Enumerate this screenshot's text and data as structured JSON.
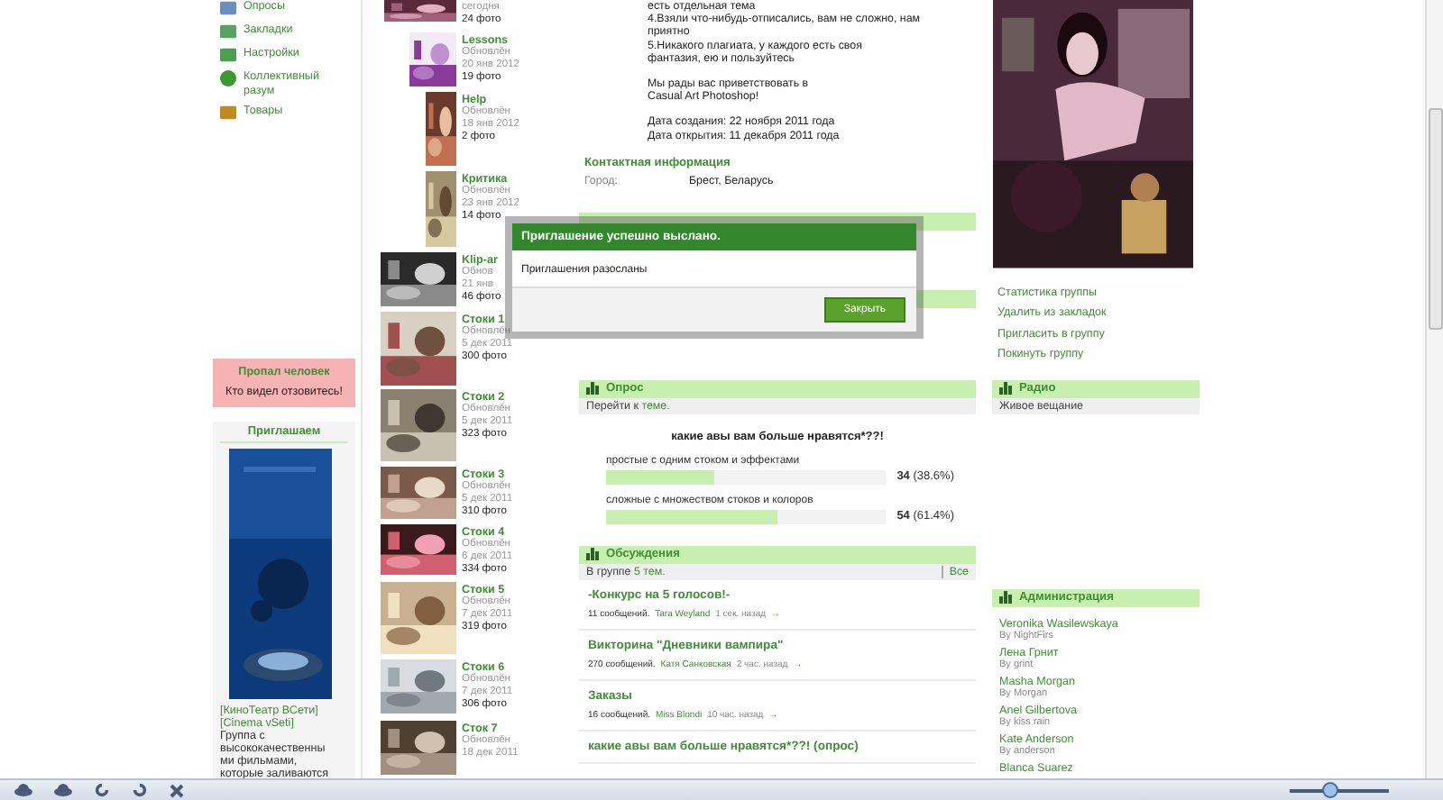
{
  "left_menu": [
    {
      "label": "Опросы"
    },
    {
      "label": "Закладки"
    },
    {
      "label": "Настройки"
    },
    {
      "label": "Коллективный разум"
    },
    {
      "label": "Товары"
    }
  ],
  "missing_box": {
    "title": "Пропал человек",
    "text": "Кто видел отзовитесь!"
  },
  "invite_box": {
    "title": "Приглашаем",
    "link": "[КиноТеатр ВСети] [Cinema vSeti]",
    "text": "Группа с высококачественными фильмами, которые заливаются"
  },
  "albums": [
    {
      "date": "сегодня",
      "count": "24 фото"
    },
    {
      "title": "Lessons",
      "status": "Обновлён",
      "date": "20 янв 2012",
      "count": "19 фото"
    },
    {
      "title": "Help",
      "status": "Обновлён",
      "date": "18 янв 2012",
      "count": "2 фото"
    },
    {
      "title": "Критика",
      "status": "Обновлён",
      "date": "23 янв 2012",
      "count": "14 фото"
    },
    {
      "title": "Klip-ar",
      "status": "Обнов",
      "date": "21 янв",
      "count": "46 фото"
    },
    {
      "title": "Стоки 1",
      "status": "Обновлён",
      "date": "5 дек 2011",
      "count": "300 фото"
    },
    {
      "title": "Стоки 2",
      "status": "Обновлён",
      "date": "5 дек 2011",
      "count": "323 фото"
    },
    {
      "title": "Стоки 3",
      "status": "Обновлён",
      "date": "5 дек 2011",
      "count": "310 фото"
    },
    {
      "title": "Стоки 4",
      "status": "Обновлён",
      "date": "6 дек 2011",
      "count": "334 фото"
    },
    {
      "title": "Стоки 5",
      "status": "Обновлён",
      "date": "7 дек 2011",
      "count": "319 фото"
    },
    {
      "title": "Стоки 6",
      "status": "Обновлён",
      "date": "7 дек 2011",
      "count": "306 фото"
    },
    {
      "title": "Сток 7",
      "status": "Обновлён",
      "date": "18 дек 2011"
    }
  ],
  "group_info": {
    "paragraphs": [
      "есть отдельная тема\n4.Взяли что-нибудь-отписались, вам не сложно, нам\nприятно\n5.Никакого плагиата, у каждого есть своя\nфантазия, ею и пользуйтесь",
      "Мы рады вас приветствовать в\nCasual Art Photoshop!",
      "Дата создания: 22 ноября 2011 года\nДата открытия: 11 декабря 2011 года"
    ]
  },
  "contacts": {
    "title": "Контактная информация",
    "fields": [
      {
        "label": "Город:",
        "value": "Брест, Беларусь"
      }
    ]
  },
  "poll": {
    "title": "Опрос",
    "goto_prefix": "Перейти к",
    "goto_link": "теме.",
    "question": "какие авы вам больше нравятся*??!",
    "options": [
      {
        "label": "простые с одним стоком и эффектами",
        "level": 0.386,
        "result": "**34** (38.6%)"
      },
      {
        "label": "сложные с множеством стоков и колоров",
        "level": 0.614,
        "result": "**54** (61.4%)"
      }
    ]
  },
  "discussions": {
    "title": "Обсуждения",
    "summary_prefix": "В группе",
    "summary_link": "5 тем.",
    "all_link": "Все",
    "topics": [
      {
        "title": "-Конкурс на 5 голосов!-",
        "messages": "11 сообщений.",
        "author": "Tara Weyland",
        "time": "1 сек. назад",
        "arrow": "→"
      },
      {
        "title": "Викторина \"Дневники вампира\"",
        "messages": "270 сообщений.",
        "author": "Катя Санковская",
        "time": "2 час. назад",
        "arrow": "→"
      },
      {
        "title": "Заказы",
        "messages": "16 сообщений.",
        "author": "Miss Blondi",
        "time": "10 час. назад",
        "arrow": "→"
      },
      {
        "title": "какие авы вам больше нравятся*??! (опрос)"
      }
    ]
  },
  "right": {
    "links": [
      "Статистика группы",
      "Удалить из закладок",
      "Пригласить в группу",
      "Покинуть группу"
    ],
    "radio": {
      "title": "Радио",
      "item": "Живое вещание"
    },
    "admins": {
      "title": "Администрация",
      "members": [
        {
          "name": "Veronika Wasilewskaya",
          "by": "By NightFirs"
        },
        {
          "name": "Лена Грнит",
          "by": "By grint"
        },
        {
          "name": "Masha Morgan",
          "by": "By Morgan"
        },
        {
          "name": "Anel Gilbertova",
          "by": "By kiss rain"
        },
        {
          "name": "Kate Anderson",
          "by": "By anderson"
        },
        {
          "name": "Blanca Suarez"
        }
      ]
    }
  },
  "modal": {
    "title": "Приглашение успешно выслано.",
    "message": "Приглашения разосланы",
    "button": "Закрыть"
  },
  "viewer_toolbar": {
    "zoom": {
      "level": 0.4
    }
  }
}
